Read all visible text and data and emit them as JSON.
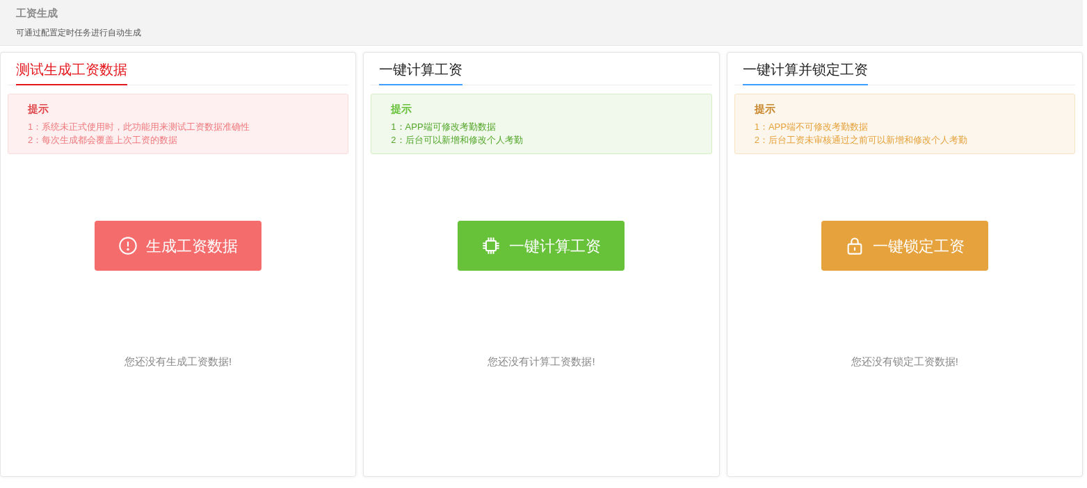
{
  "header": {
    "title": "工资生成",
    "subtitle": "可通过配置定时任务进行自动生成"
  },
  "cards": [
    {
      "kind": "danger",
      "title": "测试生成工资数据",
      "tip_title": "提示",
      "tips": [
        "1：系统未正式使用时，此功能用来测试工资数据准确性",
        "2：每次生成都会覆盖上次工资的数据"
      ],
      "button": "生成工资数据",
      "empty": "您还没有生成工资数据!"
    },
    {
      "kind": "success",
      "title": "一键计算工资",
      "tip_title": "提示",
      "tips": [
        "1：APP端可修改考勤数据",
        "2：后台可以新增和修改个人考勤"
      ],
      "button": "一键计算工资",
      "empty": "您还没有计算工资数据!"
    },
    {
      "kind": "warning",
      "title": "一键计算并锁定工资",
      "tip_title": "提示",
      "tips": [
        "1：APP端不可修改考勤数据",
        "2：后台工资未审核通过之前可以新增和修改个人考勤"
      ],
      "button": "一键锁定工资",
      "empty": "您还没有锁定工资数据!"
    }
  ]
}
